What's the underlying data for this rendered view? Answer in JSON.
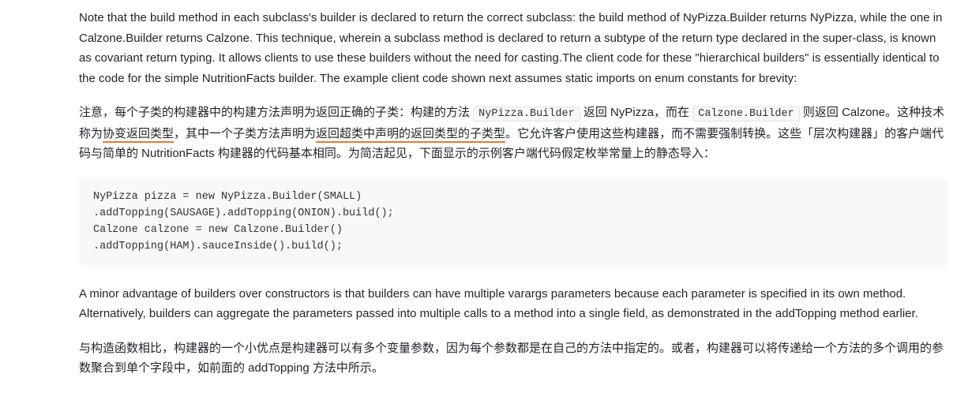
{
  "para_en_1": "Note that the build method in each subclass's builder is declared to return the correct subclass: the build method of NyPizza.Builder returns NyPizza, while the one in Calzone.Builder returns Calzone. This technique, wherein a subclass method is declared to return a subtype of the return type declared in the super-class, is known as covariant return typing. It allows clients to use these builders without the need for casting.The client code for these \"hierarchical builders\" is essentially identical to the code for the simple NutritionFacts builder. The example client code shown next assumes static imports on enum constants for brevity:",
  "para_cn_1": {
    "seg1": "注意，每个子类的构建器中的构建方法声明为返回正确的子类：构建的方法 ",
    "code1": "NyPizza.Builder",
    "seg2": " 返回 NyPizza，而在 ",
    "code2": "Calzone.Builder",
    "seg3": " 则返回 Calzone。这种技术称为",
    "annot1": "协变返回类型",
    "seg4": "，其中一个子类方法声明为",
    "annot2": "返回超类中声明的返回类型的子类型",
    "seg5": "。它允许客户使用这些构建器，而不需要强制转换。这些「层次构建器」的客户端代码与简单的 NutritionFacts 构建器的代码基本相同。为简洁起见，下面显示的示例客户端代码假定枚举常量上的静态导入："
  },
  "code_block": "NyPizza pizza = new NyPizza.Builder(SMALL)\n.addTopping(SAUSAGE).addTopping(ONION).build();\nCalzone calzone = new Calzone.Builder()\n.addTopping(HAM).sauceInside().build();",
  "para_en_2": "A minor advantage of builders over constructors is that builders can have multiple varargs parameters because each parameter is specified in its own method. Alternatively, builders can aggregate the parameters passed into multiple calls to a method into a single field, as demonstrated in the addTopping method earlier.",
  "para_cn_2": "与构造函数相比，构建器的一个小优点是构建器可以有多个变量参数，因为每个参数都是在自己的方法中指定的。或者，构建器可以将传递给一个方法的多个调用的参数聚合到单个字段中，如前面的 addTopping 方法中所示。"
}
